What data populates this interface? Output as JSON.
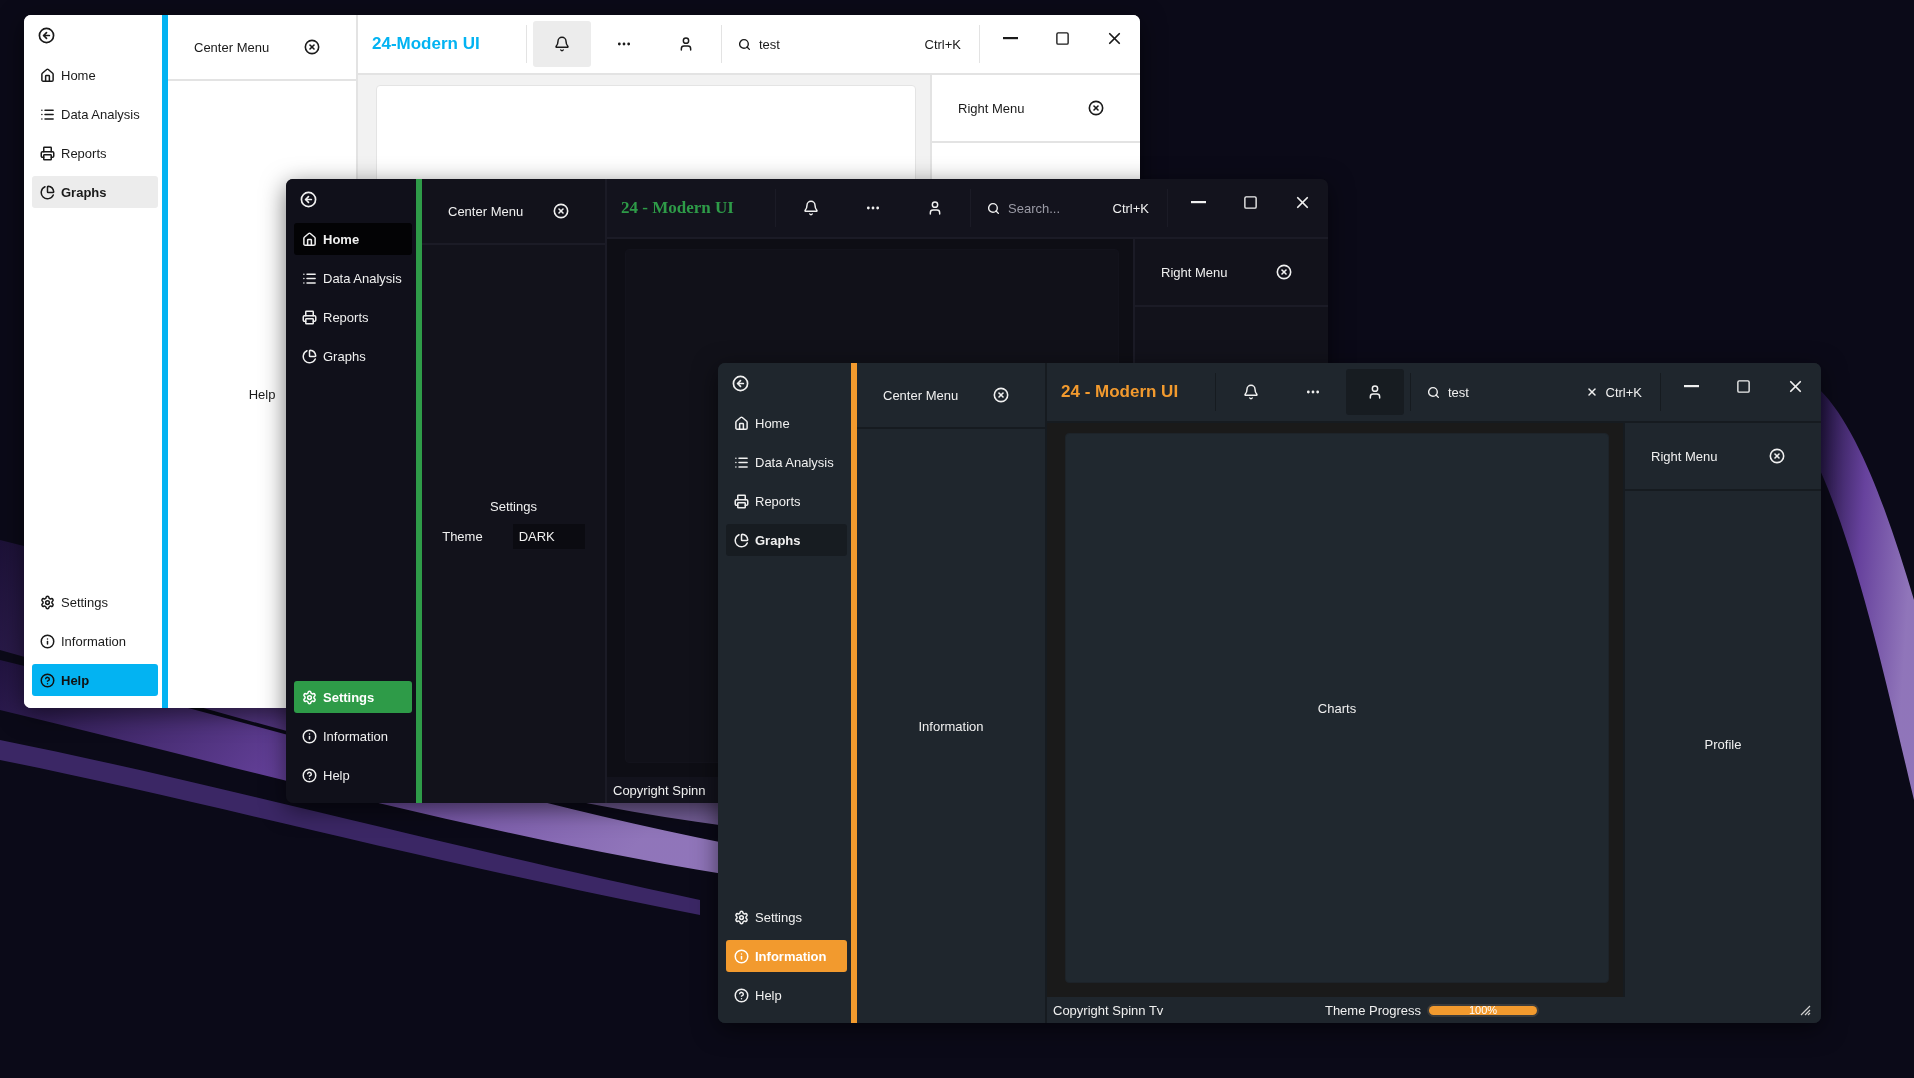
{
  "windows": [
    {
      "kind": "light",
      "color": "#03b3f2",
      "title": "24-Modern UI",
      "sidebar": {
        "top": [
          {
            "label": "Home",
            "selected": false,
            "hovered": false
          },
          {
            "label": "Data Analysis",
            "selected": false,
            "hovered": false
          },
          {
            "label": "Reports",
            "selected": false,
            "hovered": false
          },
          {
            "label": "Graphs",
            "selected": false,
            "hovered": true
          }
        ],
        "bottom": [
          {
            "label": "Settings",
            "selected": false,
            "hovered": false
          },
          {
            "label": "Information",
            "selected": false,
            "hovered": false
          },
          {
            "label": "Help",
            "selected": true,
            "hovered": false
          }
        ]
      },
      "center_menu": {
        "title": "Center Menu",
        "body": {
          "kind": "text",
          "text": "Help"
        }
      },
      "header_buttons": [
        {
          "hovered": true
        },
        {
          "hovered": false
        },
        {
          "hovered": false
        }
      ],
      "search": {
        "value": "test",
        "shortcut": "Ctrl+K"
      },
      "right_menu": {
        "title": "Right Menu"
      }
    },
    {
      "kind": "dark",
      "color": "#2e9b48",
      "title": "24 - Modern UI",
      "sidebar": {
        "top": [
          {
            "label": "Home",
            "selected": false,
            "hovered": true
          },
          {
            "label": "Data Analysis",
            "selected": false,
            "hovered": false
          },
          {
            "label": "Reports",
            "selected": false,
            "hovered": false
          },
          {
            "label": "Graphs",
            "selected": false,
            "hovered": false
          }
        ],
        "bottom": [
          {
            "label": "Settings",
            "selected": true,
            "hovered": false
          },
          {
            "label": "Information",
            "selected": false,
            "hovered": false
          },
          {
            "label": "Help",
            "selected": false,
            "hovered": false
          }
        ]
      },
      "center_menu": {
        "title": "Center Menu",
        "body": {
          "kind": "settings",
          "title": "Settings",
          "label": "Theme",
          "value": "DARK"
        }
      },
      "header_buttons": [
        {
          "hovered": false
        },
        {
          "hovered": false
        },
        {
          "hovered": false
        }
      ],
      "search": {
        "placeholder": "Search...",
        "shortcut": "Ctrl+K"
      },
      "right_menu": {
        "title": "Right Menu"
      },
      "footer": {
        "copyright": "Copyright Spinn"
      }
    },
    {
      "kind": "slate",
      "color": "#f29a2e",
      "title": "24 - Modern UI",
      "sidebar": {
        "top": [
          {
            "label": "Home",
            "selected": false,
            "hovered": false
          },
          {
            "label": "Data Analysis",
            "selected": false,
            "hovered": false
          },
          {
            "label": "Reports",
            "selected": false,
            "hovered": false
          },
          {
            "label": "Graphs",
            "selected": false,
            "hovered": true
          }
        ],
        "bottom": [
          {
            "label": "Settings",
            "selected": false,
            "hovered": false
          },
          {
            "label": "Information",
            "selected": true,
            "hovered": false
          },
          {
            "label": "Help",
            "selected": false,
            "hovered": false
          }
        ]
      },
      "center_menu": {
        "title": "Center Menu",
        "body": {
          "kind": "text",
          "text": "Information"
        }
      },
      "header_buttons": [
        {
          "hovered": false
        },
        {
          "hovered": false
        },
        {
          "hovered": true
        }
      ],
      "search": {
        "value": "test",
        "clearable": true,
        "shortcut": "Ctrl+K"
      },
      "main": {
        "text": "Charts"
      },
      "right_menu": {
        "title": "Right Menu",
        "body": "Profile"
      },
      "footer": {
        "copyright": "Copyright Spinn Tv",
        "progress": {
          "label": "Theme Progress",
          "level": 1,
          "reading": "100%"
        }
      }
    }
  ]
}
